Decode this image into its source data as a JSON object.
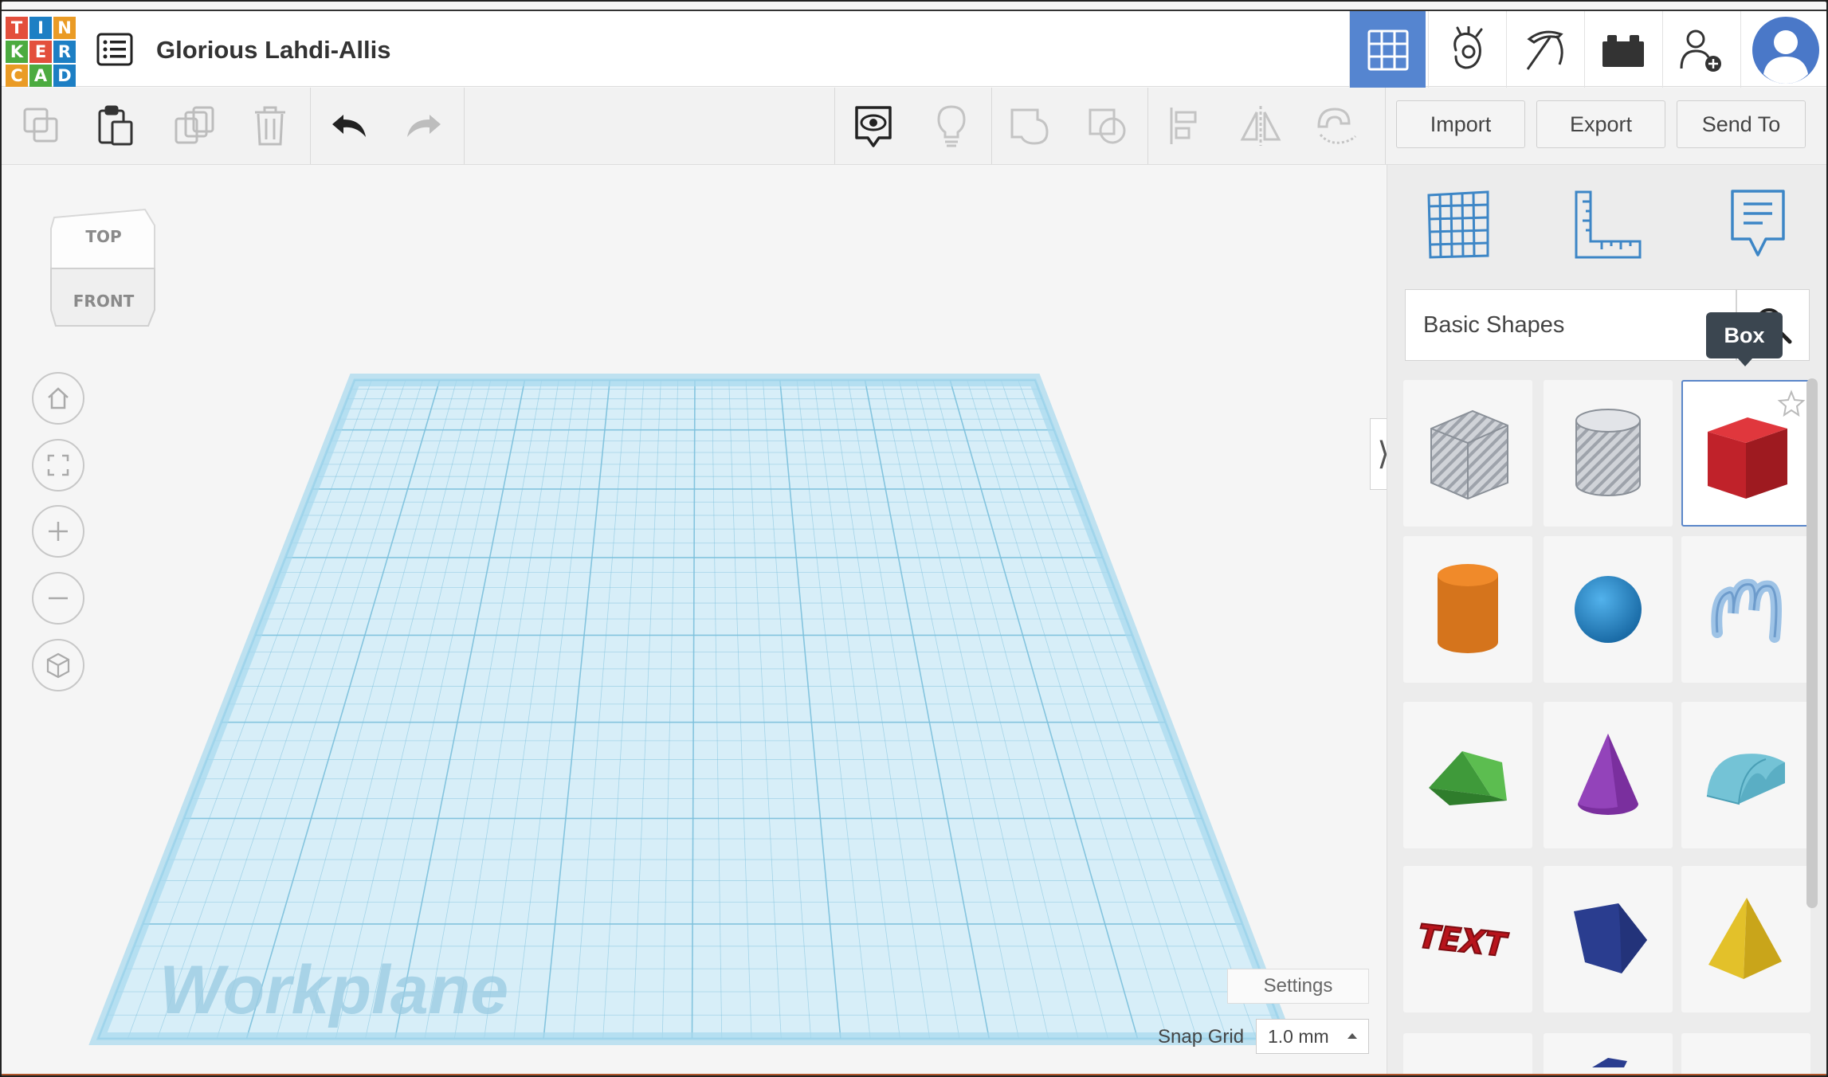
{
  "app": {
    "name": "Tinkercad",
    "logo_letters": [
      "T",
      "I",
      "N",
      "K",
      "E",
      "R",
      "C",
      "A",
      "D"
    ],
    "logo_colors": [
      "#e34f3c",
      "#1d7fc4",
      "#ea9b25",
      "#4cab40",
      "#e34f3c",
      "#1d7fc4",
      "#ea9b25",
      "#4cab40",
      "#1d7fc4"
    ]
  },
  "header": {
    "project_title": "Glorious Lahdi-Allis",
    "nav": [
      {
        "name": "3d-design",
        "icon": "grid-icon",
        "active": true
      },
      {
        "name": "codeblocks",
        "icon": "gesture-hand-icon"
      },
      {
        "name": "minecraft",
        "icon": "pickaxe-icon"
      },
      {
        "name": "lego",
        "icon": "brick-icon"
      },
      {
        "name": "invite",
        "icon": "add-user-icon"
      },
      {
        "name": "profile",
        "icon": "avatar-icon"
      }
    ]
  },
  "toolbar": {
    "tools": [
      "copy-icon",
      "paste-icon",
      "duplicate-icon",
      "delete-icon",
      "undo-icon",
      "redo-icon",
      "notes-visibility-icon",
      "lightbulb-icon",
      "group-icon",
      "ungroup-icon",
      "align-icon",
      "mirror-icon",
      "magnet-icon"
    ],
    "import_label": "Import",
    "export_label": "Export",
    "send_to_label": "Send To"
  },
  "viewcube": {
    "top_label": "TOP",
    "front_label": "FRONT"
  },
  "workplane": {
    "label": "Workplane",
    "color": "#9dd6ef"
  },
  "canvas": {
    "settings_label": "Settings",
    "snap_grid_label": "Snap Grid",
    "snap_grid_value": "1.0 mm"
  },
  "panel": {
    "icons": [
      "workplane-grid-icon",
      "ruler-icon",
      "notes-icon"
    ],
    "category": "Basic Shapes",
    "tooltip": "Box",
    "shapes": [
      {
        "name": "Box (hole)",
        "icon": "box-hole-icon"
      },
      {
        "name": "Cylinder (hole)",
        "icon": "cylinder-hole-icon"
      },
      {
        "name": "Box",
        "icon": "box-icon",
        "selected": true
      },
      {
        "name": "Cylinder",
        "icon": "cylinder-icon"
      },
      {
        "name": "Sphere",
        "icon": "sphere-icon"
      },
      {
        "name": "Scribble",
        "icon": "scribble-icon"
      },
      {
        "name": "Roof",
        "icon": "roof-icon"
      },
      {
        "name": "Cone",
        "icon": "cone-icon"
      },
      {
        "name": "Round Roof",
        "icon": "round-roof-icon"
      },
      {
        "name": "Text",
        "icon": "text-shape-icon",
        "text": "TEXT"
      },
      {
        "name": "Polygon",
        "icon": "polygon-icon"
      },
      {
        "name": "Pyramid",
        "icon": "pyramid-icon"
      }
    ]
  }
}
